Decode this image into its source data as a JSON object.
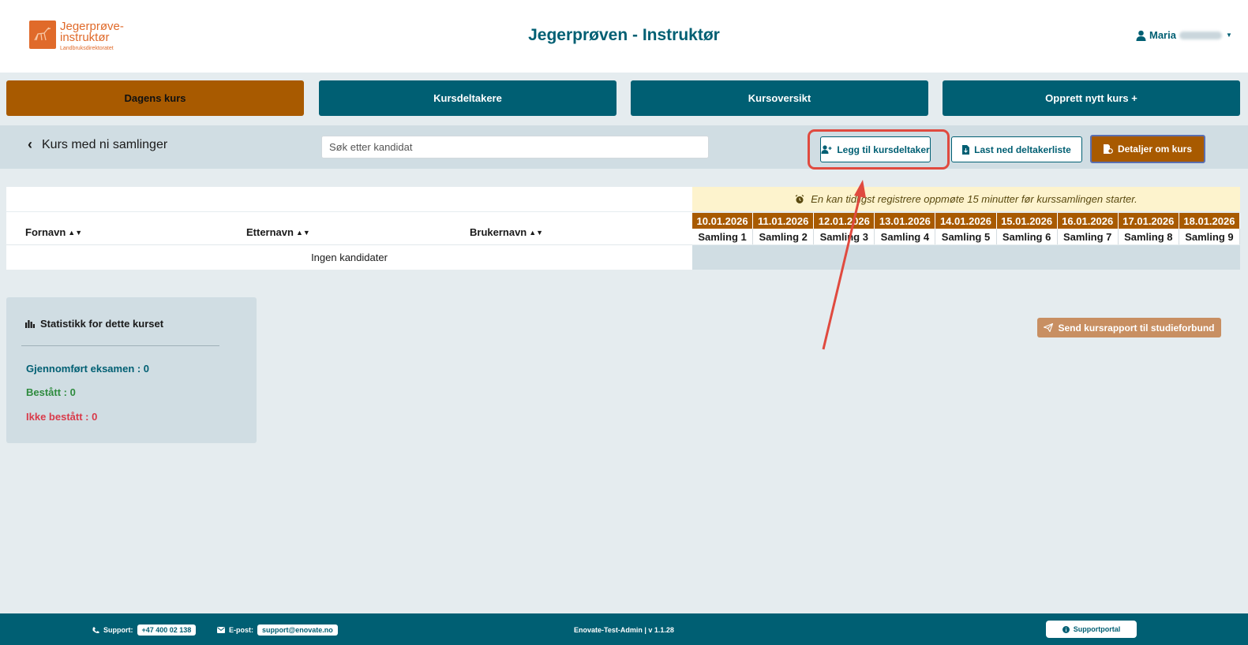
{
  "header": {
    "logo_line1": "Jegerprøve-",
    "logo_line2": "instruktør",
    "logo_line3": "Landbruksdirektoratet",
    "title": "Jegerprøven - Instruktør",
    "user_name": "Maria"
  },
  "nav": {
    "items": [
      {
        "label": "Dagens kurs",
        "active": true
      },
      {
        "label": "Kursdeltakere",
        "active": false
      },
      {
        "label": "Kursoversikt",
        "active": false
      },
      {
        "label": "Opprett nytt kurs +",
        "active": false
      }
    ]
  },
  "subheader": {
    "course_title": "Kurs med ni samlinger",
    "search_placeholder": "Søk etter kandidat",
    "add_participant": "Legg til kursdeltaker",
    "download_list": "Last ned deltakerliste",
    "course_details": "Detaljer om kurs"
  },
  "table": {
    "notice": "En kan tidligst registrere oppmøte 15 minutter før kurssamlingen starter.",
    "columns": [
      "Fornavn",
      "Etternavn",
      "Brukernavn"
    ],
    "empty_text": "Ingen kandidater",
    "sessions": [
      {
        "date": "10.01.2026",
        "name": "Samling 1"
      },
      {
        "date": "11.01.2026",
        "name": "Samling 2"
      },
      {
        "date": "12.01.2026",
        "name": "Samling 3"
      },
      {
        "date": "13.01.2026",
        "name": "Samling 4"
      },
      {
        "date": "14.01.2026",
        "name": "Samling 5"
      },
      {
        "date": "15.01.2026",
        "name": "Samling 6"
      },
      {
        "date": "16.01.2026",
        "name": "Samling 7"
      },
      {
        "date": "17.01.2026",
        "name": "Samling 8"
      },
      {
        "date": "18.01.2026",
        "name": "Samling 9"
      }
    ]
  },
  "stats": {
    "title": "Statistikk for dette kurset",
    "completed": "Gjennomført eksamen : 0",
    "passed": "Bestått : 0",
    "failed": "Ikke bestått : 0"
  },
  "report_button": "Send kursrapport til studieforbund",
  "footer": {
    "support_label": "Support:",
    "support_phone": "+47 400 02 138",
    "email_label": "E-post:",
    "email": "support@enovate.no",
    "version": "Enovate-Test-Admin | v 1.1.28",
    "portal": "Supportportal"
  },
  "colors": {
    "teal": "#005f73",
    "brown": "#a85a00",
    "highlight": "#e04a3f",
    "passed": "#2e8b3e",
    "failed": "#d93a4a"
  }
}
